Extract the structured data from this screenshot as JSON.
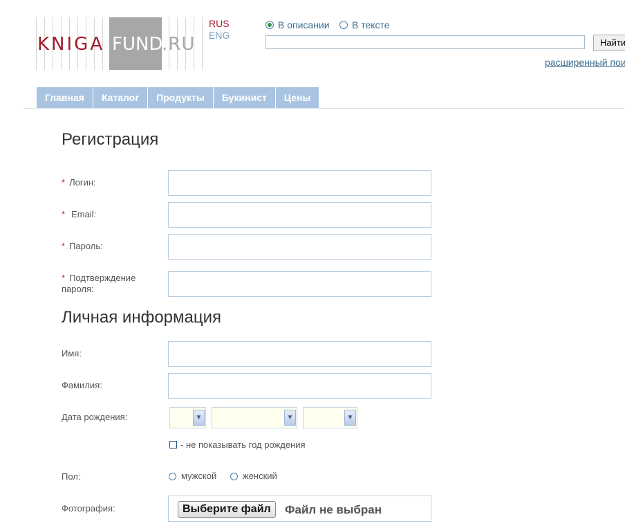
{
  "header": {
    "logo": {
      "part1": "KNIGA",
      "part2": "FUND",
      "part3": ".RU"
    },
    "lang": {
      "rus": "RUS",
      "eng": "ENG"
    },
    "search": {
      "mode_description": "В описании",
      "mode_text": "В тексте",
      "selected_mode": "В описании",
      "query": "",
      "button": "Найти",
      "advanced_link": "расширенный поиск"
    }
  },
  "nav": {
    "items": [
      "Главная",
      "Каталог",
      "Продукты",
      "Букинист",
      "Цены"
    ]
  },
  "form": {
    "title": "Регистрация",
    "required_mark": "*",
    "login_label": "Логин:",
    "email_label": "Email:",
    "password_label": "Пароль:",
    "confirm_label_1": "Подтверждение",
    "confirm_label_2": "пароля:",
    "personal_title": "Личная информация",
    "first_name_label": "Имя:",
    "last_name_label": "Фамилия:",
    "birthdate_label": "Дата рождения:",
    "hide_year_label": "- не показывать год рождения",
    "gender_label": "Пол:",
    "male": "мужской",
    "female": "женский",
    "photo_label": "Фотография:",
    "file_button": "Выберите файл",
    "file_status": "Файл не выбран"
  },
  "colors": {
    "brand_red": "#a01c2c",
    "nav_bg": "#a9c4e0",
    "link": "#3f6f90"
  }
}
